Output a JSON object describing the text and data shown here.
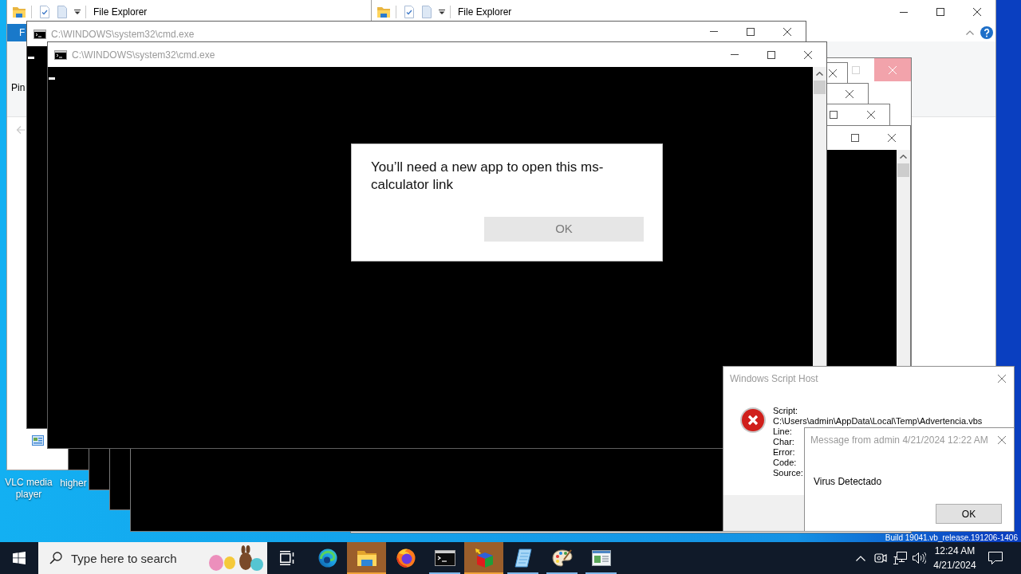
{
  "desktop": {
    "icons": [
      {
        "label": "VLC media player"
      },
      {
        "label": "higher"
      }
    ],
    "build_text": "Build 19041.vb_release.191206-1406"
  },
  "explorer_windows": [
    {
      "title": "File Explorer",
      "file_tab": "F",
      "ribbon_text": "Pin"
    },
    {
      "title": "File Explorer"
    }
  ],
  "background_windows": [
    {
      "kind": "dialog",
      "buttons": [
        {
          "kind": "maximize",
          "hovered": false
        },
        {
          "kind": "close",
          "hovered": true
        }
      ]
    },
    {
      "kind": "console",
      "buttons": [
        {
          "kind": "close",
          "hovered": false
        }
      ]
    },
    {
      "kind": "console",
      "buttons": [
        {
          "kind": "close",
          "hovered": false
        }
      ]
    },
    {
      "kind": "console",
      "buttons": [
        {
          "kind": "maximize",
          "hovered": false
        },
        {
          "kind": "close",
          "hovered": false
        }
      ]
    },
    {
      "kind": "console",
      "buttons": [
        {
          "kind": "maximize",
          "hovered": false
        },
        {
          "kind": "close",
          "hovered": false
        }
      ]
    }
  ],
  "console_windows": [
    {
      "title": "C:\\WINDOWS\\system32\\cmd.exe"
    },
    {
      "title": "C:\\WINDOWS\\system32\\cmd.exe"
    }
  ],
  "app_dialog": {
    "message": "You’ll need a new app to open this ms-calculator link",
    "button": "OK"
  },
  "script_host_dialog": {
    "title": "Windows Script Host",
    "lines": [
      "Script:",
      "C:\\Users\\admin\\AppData\\Local\\Temp\\Advertencia.vbs",
      "Line:",
      "Char:",
      "Error:",
      "Code:",
      "Source:"
    ]
  },
  "message_dialog": {
    "title": "Message from admin 4/21/2024 12:22 AM",
    "message": "Virus Detectado",
    "button": "OK"
  },
  "taskbar": {
    "search": {
      "placeholder": "Type here to search"
    },
    "apps": [
      {
        "kind": "edge",
        "running": false,
        "flashing": false
      },
      {
        "kind": "explorer",
        "running": true,
        "flashing": true
      },
      {
        "kind": "firefox",
        "running": false,
        "flashing": false
      },
      {
        "kind": "console",
        "running": true,
        "flashing": false
      },
      {
        "kind": "cube",
        "running": true,
        "flashing": true
      },
      {
        "kind": "notepad",
        "running": true,
        "flashing": false
      },
      {
        "kind": "paint",
        "running": true,
        "flashing": false
      },
      {
        "kind": "viewer",
        "running": true,
        "flashing": false
      }
    ],
    "clock": {
      "time": "12:24 AM",
      "date": "4/21/2024"
    }
  }
}
